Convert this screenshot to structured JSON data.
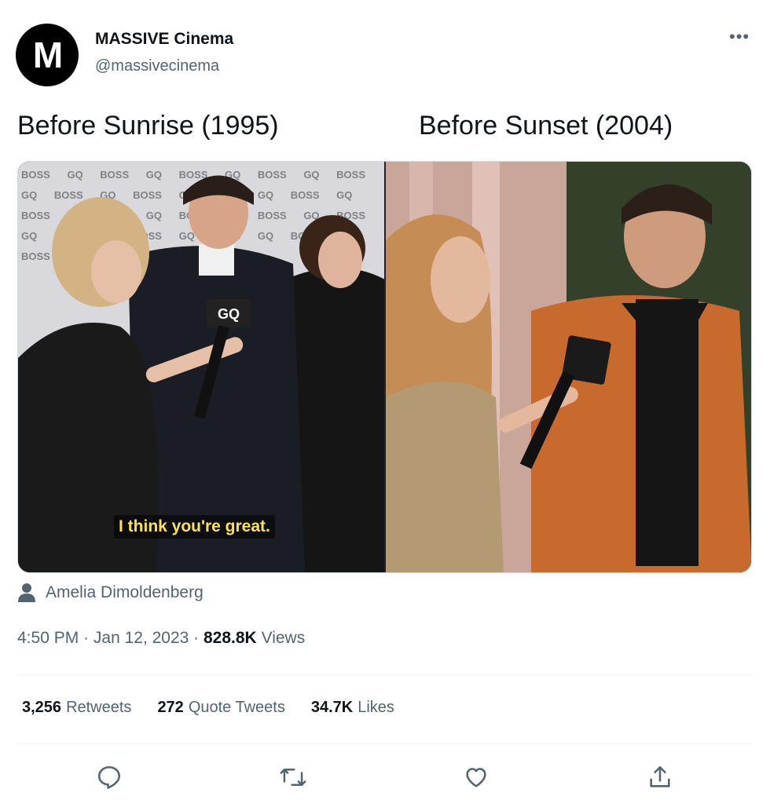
{
  "author": {
    "name": "MASSIVE Cinema",
    "handle": "@massivecinema",
    "avatar_letter": "M"
  },
  "more_label": "•••",
  "tweet": {
    "text_left": "Before Sunrise (1995)",
    "text_right": "Before Sunset (2004)"
  },
  "media": {
    "left_caption": "I think you're great.",
    "left_wall_text": "BOSS GQ BOSS GQ BOSS GQ BOSS GQ BOSS GQ BOSS GQ BOSS GQ BOSS GQ BOSS GQ BOSS GQ BOSS GQ BOSS GQ BOSS GQ BOSS GQ BOSS GQ BOSS GQ BOSS GQ BOSS GQ BOSS GQ",
    "mic_label": "GQ"
  },
  "credit": "Amelia Dimoldenberg",
  "meta": {
    "time": "4:50 PM",
    "sep": " · ",
    "date": "Jan 12, 2023",
    "views_count": "828.8K",
    "views_label": "Views"
  },
  "stats": {
    "retweets_count": "3,256",
    "retweets_label": "Retweets",
    "quotes_count": "272",
    "quotes_label": "Quote Tweets",
    "likes_count": "34.7K",
    "likes_label": "Likes"
  },
  "colors": {
    "text": "#0f1419",
    "secondary": "#536471",
    "caption": "#ffe34d",
    "jacket": "#c8692e"
  }
}
